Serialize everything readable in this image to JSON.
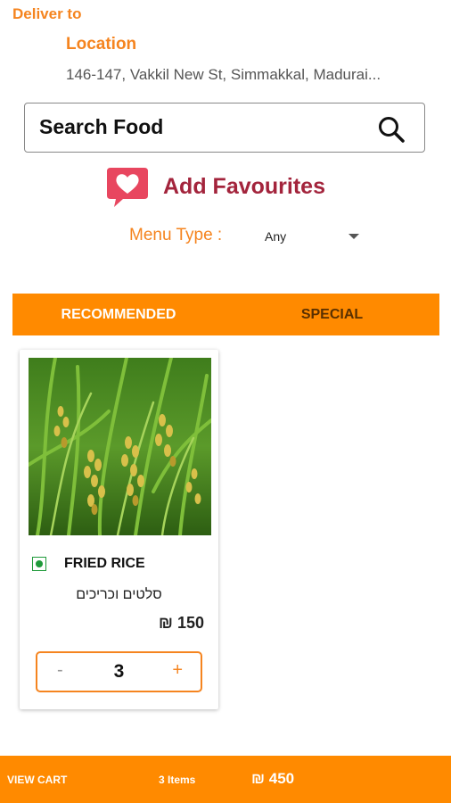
{
  "header": {
    "deliver_to": "Deliver to",
    "location_title": "Location",
    "address": "146-147, Vakkil New St, Simmakkal, Madurai..."
  },
  "search": {
    "placeholder": "Search Food",
    "icon": "search-icon"
  },
  "favourites": {
    "label": "Add Favourites",
    "icon": "heart-chat-icon"
  },
  "menu_type": {
    "label": "Menu Type :",
    "value": "Any"
  },
  "tabs": [
    {
      "label": "RECOMMENDED",
      "active": true
    },
    {
      "label": "SPECIAL",
      "active": false
    }
  ],
  "products": [
    {
      "name": "FRIED RICE",
      "description": "סלטים וכריכים",
      "price": "₪ 150",
      "quantity": "3",
      "minus": "-",
      "plus": "+",
      "veg": true
    }
  ],
  "cart": {
    "view_label": "VIEW CART",
    "items": "3 Items",
    "total": "₪ 450"
  },
  "colors": {
    "accent": "#ff8a00",
    "brand_text": "#f5841f",
    "favourite": "#a3243c",
    "veg": "#1f9a3a"
  }
}
